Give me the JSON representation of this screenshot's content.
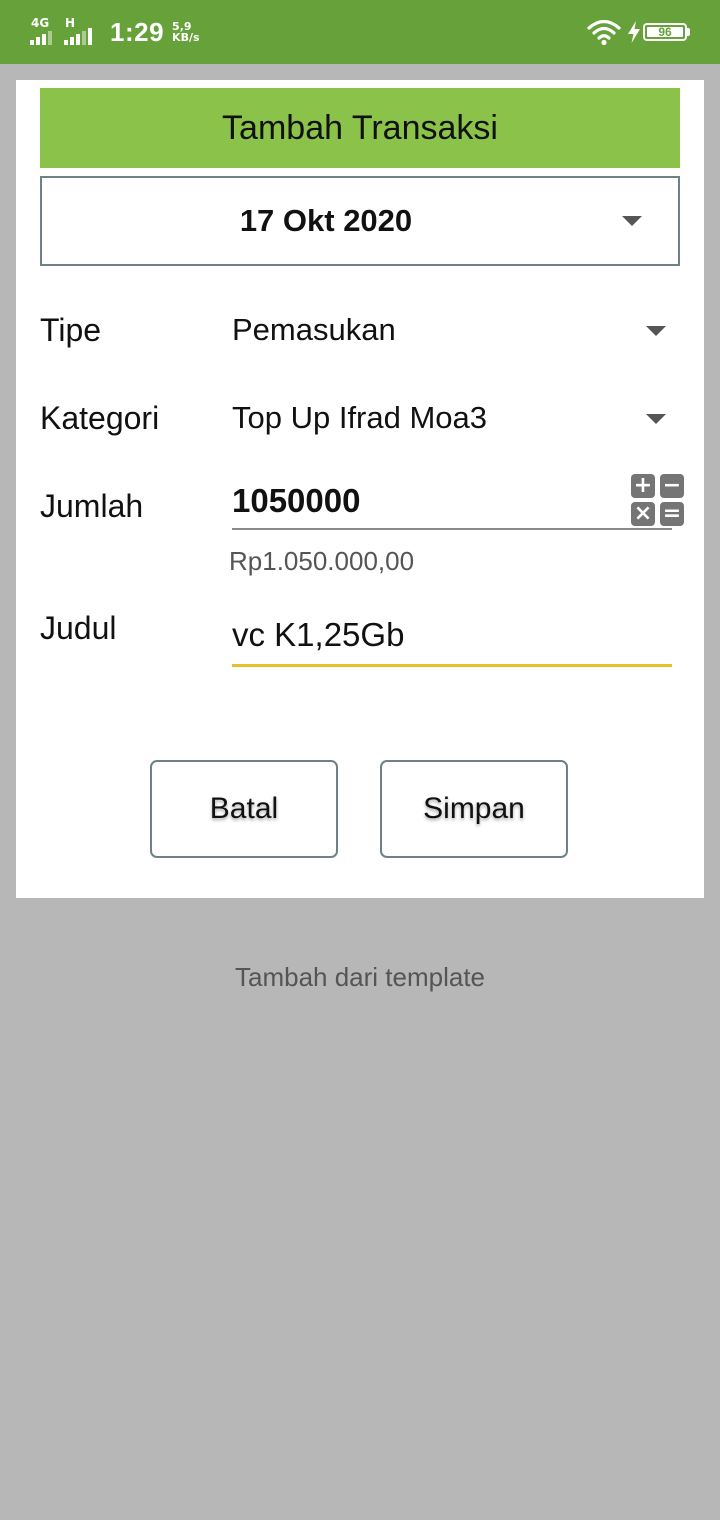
{
  "status_bar": {
    "network1": "4G",
    "network2": "H",
    "time": "1:29",
    "speed_value": "5,9",
    "speed_unit": "KB/s",
    "battery": "96",
    "wifi_icon": "wifi-icon",
    "charging_icon": "bolt-icon"
  },
  "dialog": {
    "title": "Tambah Transaksi",
    "date": "17 Okt 2020",
    "fields": {
      "type_label": "Tipe",
      "type_value": "Pemasukan",
      "category_label": "Kategori",
      "category_value": "Top Up Ifrad Moa3",
      "amount_label": "Jumlah",
      "amount_value": "1050000",
      "amount_formatted": "Rp1.050.000,00",
      "title_label": "Judul",
      "title_value": "vc K1,25Gb"
    },
    "calculator": {
      "plus": "+",
      "minus": "−",
      "times": "×",
      "equals": "="
    },
    "buttons": {
      "cancel": "Batal",
      "save": "Simpan"
    }
  },
  "template_link": "Tambah dari template",
  "colors": {
    "status_bar": "#66a13a",
    "header": "#8bc34a",
    "backdrop": "#b7b7b7",
    "focus_underline": "#e8c12a"
  }
}
